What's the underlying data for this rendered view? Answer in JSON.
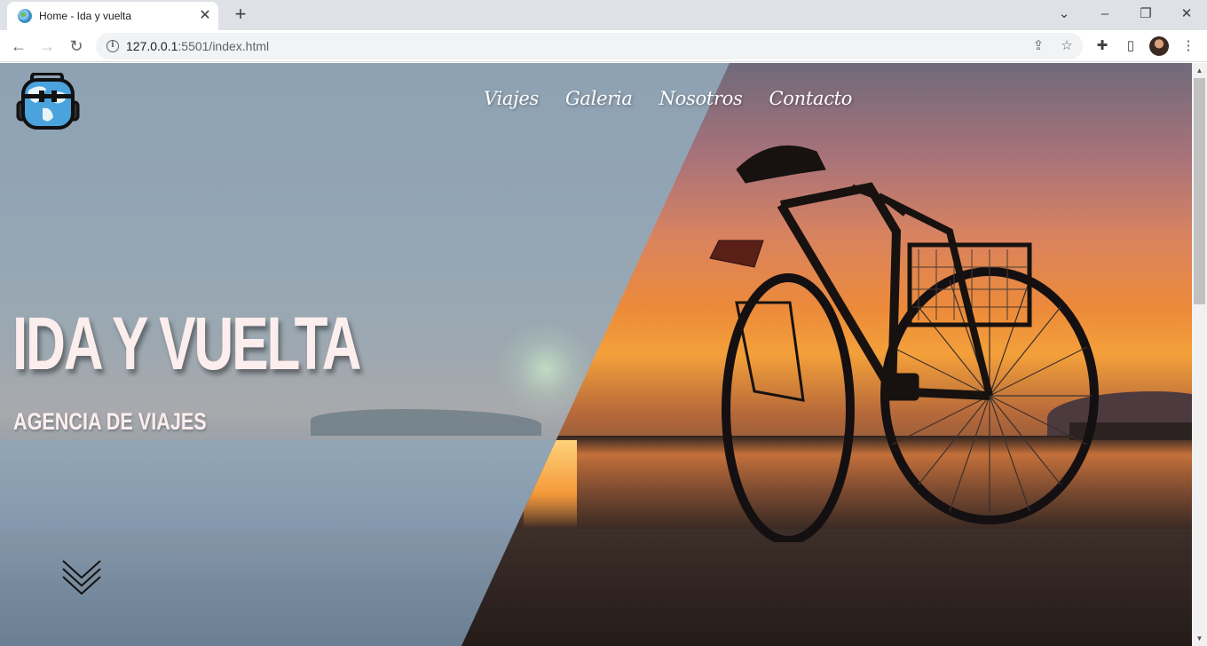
{
  "browser": {
    "tab_title": "Home - Ida y vuelta",
    "url_host": "127.0.0.1",
    "url_rest": ":5501/index.html"
  },
  "site": {
    "nav": [
      "Viajes",
      "Galeria",
      "Nosotros",
      "Contacto"
    ],
    "hero_title": "IDA Y VUELTA",
    "hero_subtitle": "AGENCIA DE VIAJES"
  },
  "colors": {
    "hero_text": "#fdeeee",
    "nav_text": "#ffffff"
  }
}
